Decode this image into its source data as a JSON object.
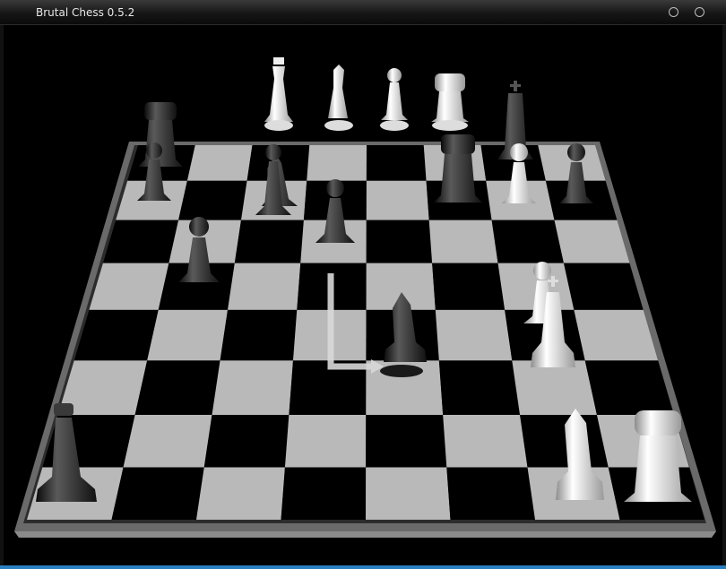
{
  "window": {
    "title": "Brutal Chess 0.5.2",
    "buttons": [
      "maximize-button",
      "close-button"
    ],
    "accent_color": "#2a7fbf"
  },
  "board": {
    "light_square": "#b9b9b9",
    "dark_square": "#000000",
    "frame_color": "#5a5a5a",
    "move_hint": "L-shaped knight move indicator"
  },
  "pieces": [
    {
      "name": "white-queen",
      "color": "white",
      "type": "queen"
    },
    {
      "name": "white-bishop",
      "color": "white",
      "type": "bishop"
    },
    {
      "name": "white-pawn",
      "color": "white",
      "type": "pawn"
    },
    {
      "name": "white-rook",
      "color": "white",
      "type": "rook"
    },
    {
      "name": "black-king",
      "color": "black",
      "type": "king"
    },
    {
      "name": "black-rook",
      "color": "black",
      "type": "rook"
    },
    {
      "name": "black-knight",
      "color": "black",
      "type": "knight"
    },
    {
      "name": "black-queen",
      "color": "black",
      "type": "queen"
    },
    {
      "name": "white-king",
      "color": "white",
      "type": "king"
    },
    {
      "name": "white-knight",
      "color": "white",
      "type": "knight"
    }
  ]
}
